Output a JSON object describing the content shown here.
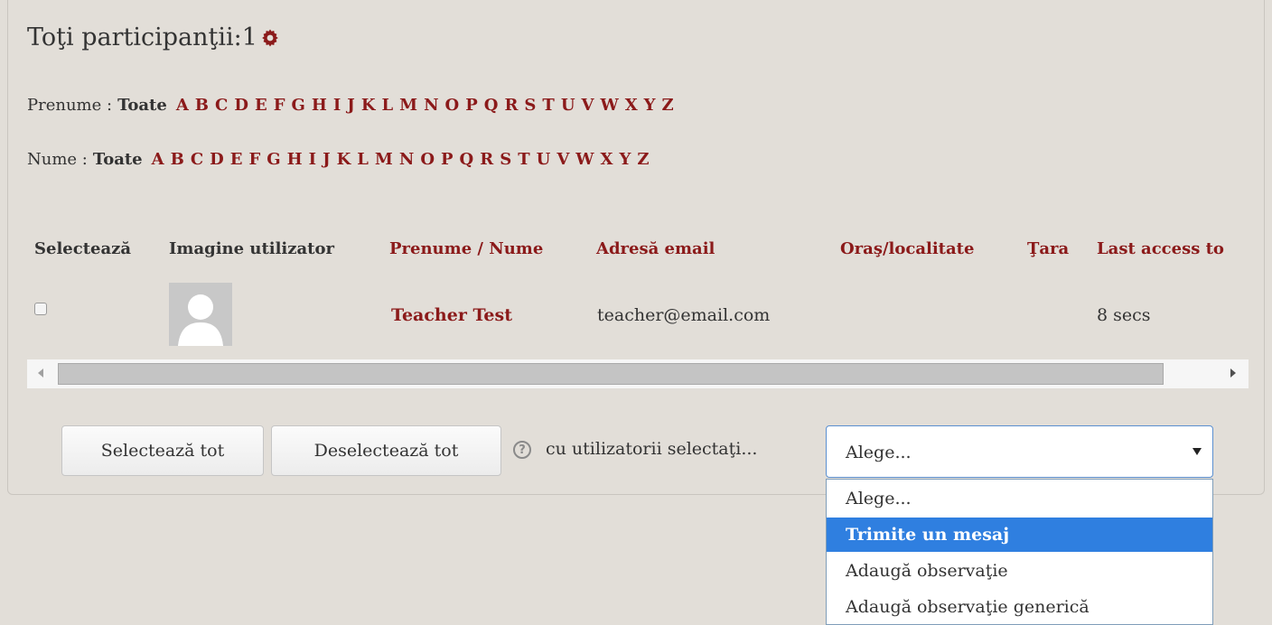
{
  "header": {
    "title": "Toţi participanţii:1",
    "settings_icon": "gear-icon"
  },
  "filters": {
    "firstname": {
      "label": "Prenume :",
      "all": "Toate"
    },
    "lastname": {
      "label": "Nume :",
      "all": "Toate"
    },
    "letters": [
      "A",
      "B",
      "C",
      "D",
      "E",
      "F",
      "G",
      "H",
      "I",
      "J",
      "K",
      "L",
      "M",
      "N",
      "O",
      "P",
      "Q",
      "R",
      "S",
      "T",
      "U",
      "V",
      "W",
      "X",
      "Y",
      "Z"
    ]
  },
  "table": {
    "columns": {
      "select": "Selectează",
      "picture": "Imagine utilizator",
      "name": "Prenume / Nume",
      "email": "Adresă email",
      "city": "Oraş/localitate",
      "country": "Ţara",
      "last_access": "Last access to"
    },
    "rows": [
      {
        "name": "Teacher Test",
        "email": "teacher@email.com",
        "city": "",
        "country": "",
        "last_access": "8 secs"
      }
    ]
  },
  "actions": {
    "select_all": "Selectează tot",
    "deselect_all": "Deselectează tot",
    "help_icon": "question-icon",
    "with_selected": "cu utilizatorii selectaţi...",
    "select_value": "Alege...",
    "options": [
      "Alege...",
      "Trimite un mesaj",
      "Adaugă observaţie",
      "Adaugă observaţie generică"
    ],
    "highlighted_option": "Trimite un mesaj"
  },
  "colors": {
    "link": "#8b1a1a",
    "background": "#e2ded8",
    "highlight": "#2f7fe0"
  }
}
